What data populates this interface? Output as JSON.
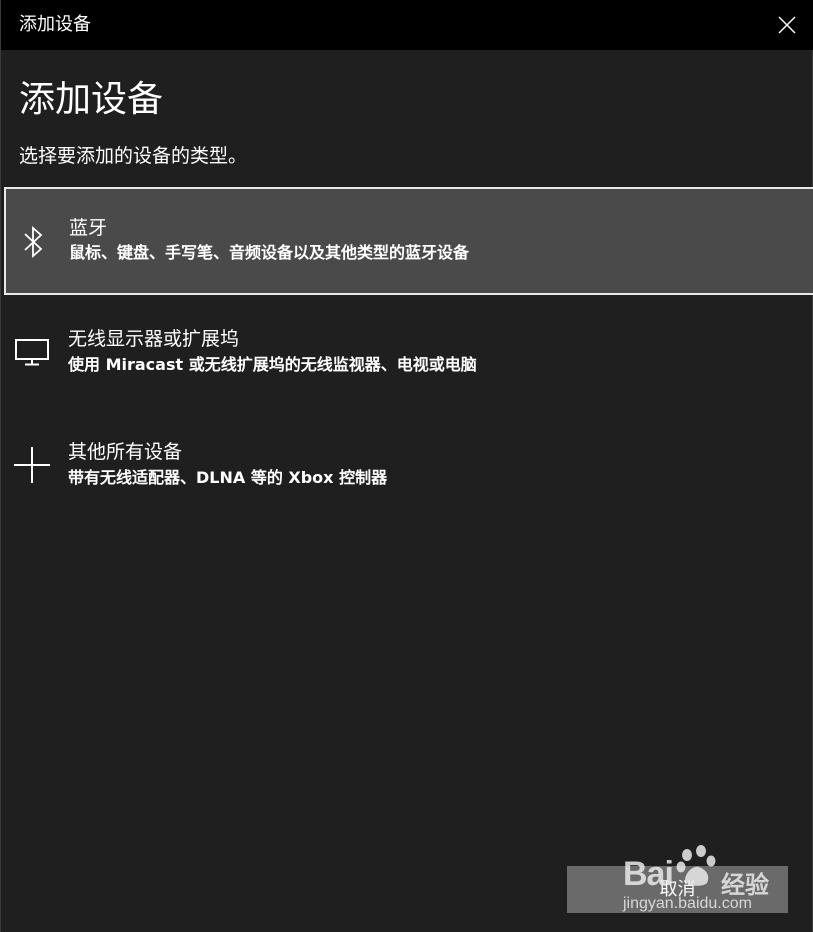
{
  "window": {
    "title": "添加设备",
    "close_icon": "close-icon"
  },
  "page": {
    "heading": "添加设备",
    "subtitle": "选择要添加的设备的类型。"
  },
  "options": [
    {
      "title": "蓝牙",
      "description": "鼠标、键盘、手写笔、音频设备以及其他类型的蓝牙设备",
      "icon": "bluetooth-icon",
      "selected": true
    },
    {
      "title": "无线显示器或扩展坞",
      "description": "使用 Miracast 或无线扩展坞的无线监视器、电视或电脑",
      "icon": "monitor-icon",
      "selected": false
    },
    {
      "title": "其他所有设备",
      "description": "带有无线适配器、DLNA 等的 Xbox 控制器",
      "icon": "plus-icon",
      "selected": false
    }
  ],
  "footer": {
    "cancel_label": "取消"
  },
  "watermark": {
    "brand": "Bai",
    "jingyan": "经验",
    "url": "jingyan.baidu.com"
  },
  "colors": {
    "background": "#1f1f1f",
    "titlebar": "#000000",
    "selected_option": "#4a4a4a",
    "selected_border": "#e8e8e8",
    "cancel_button": "#6a6a6a",
    "text": "#ffffff"
  }
}
